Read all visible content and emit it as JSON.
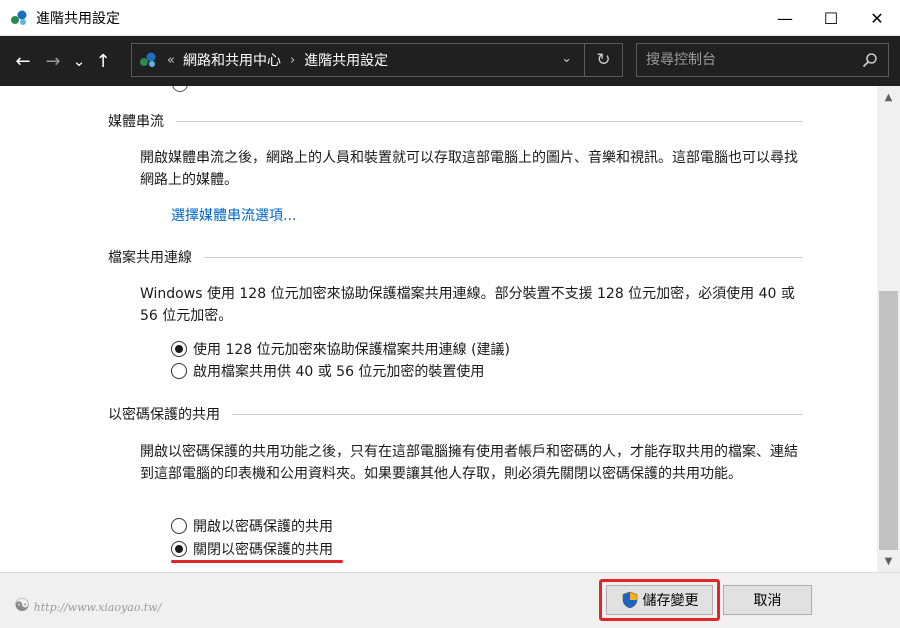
{
  "window": {
    "title": "進階共用設定",
    "minimize_glyph": "—",
    "maximize_glyph": "☐",
    "close_glyph": "✕"
  },
  "nav": {
    "back_glyph": "←",
    "forward_glyph": "→",
    "recent_glyph": "⌄",
    "up_glyph": "↑"
  },
  "address": {
    "overflow_glyph": "«",
    "crumbs": [
      "網路和共用中心",
      "進階共用設定"
    ],
    "chevron_glyph": "›",
    "dropdown_glyph": "⌄",
    "refresh_glyph": "↻"
  },
  "search": {
    "placeholder": "搜尋控制台"
  },
  "sections": {
    "media": {
      "heading": "媒體串流",
      "text": "開啟媒體串流之後，網路上的人員和裝置就可以存取這部電腦上的圖片、音樂和視訊。這部電腦也可以尋找網路上的媒體。",
      "link": "選擇媒體串流選項..."
    },
    "file_sharing": {
      "heading": "檔案共用連線",
      "text": "Windows 使用 128 位元加密來協助保護檔案共用連線。部分裝置不支援 128 位元加密，必須使用 40 或 56 位元加密。",
      "options": [
        {
          "label": "使用 128 位元加密來協助保護檔案共用連線 (建議)",
          "selected": true
        },
        {
          "label": "啟用檔案共用供 40 或 56 位元加密的裝置使用",
          "selected": false
        }
      ]
    },
    "password": {
      "heading": "以密碼保護的共用",
      "text": "開啟以密碼保護的共用功能之後，只有在這部電腦擁有使用者帳戶和密碼的人，才能存取共用的檔案、連結到這部電腦的印表機和公用資料夾。如果要讓其他人存取，則必須先關閉以密碼保護的共用功能。",
      "options": [
        {
          "label": "開啟以密碼保護的共用",
          "selected": false
        },
        {
          "label": "關閉以密碼保護的共用",
          "selected": true
        }
      ]
    }
  },
  "buttons": {
    "save": "儲存變更",
    "cancel": "取消"
  },
  "scroll": {
    "up_glyph": "▲",
    "down_glyph": "▼",
    "position": 0.78
  },
  "watermark": {
    "text": "http://www.xiaoyao.tw/"
  },
  "colors": {
    "accent_link": "#0066cc",
    "highlight_red": "#e0262b",
    "navbar_bg": "#202020"
  }
}
